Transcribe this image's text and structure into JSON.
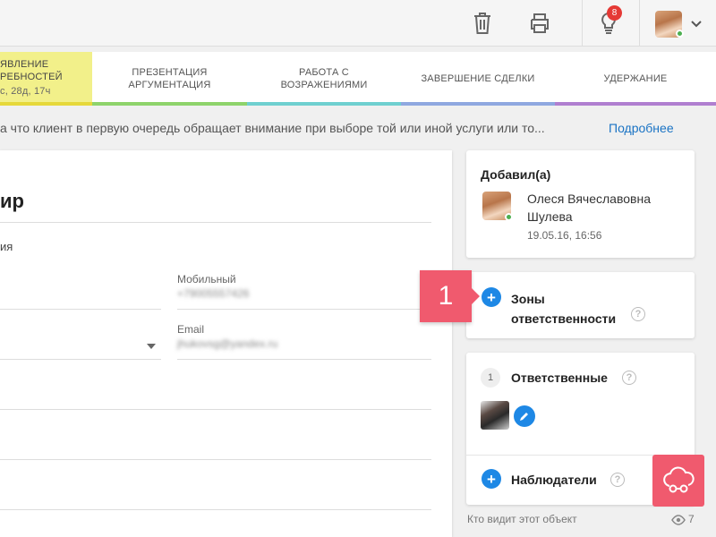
{
  "badge_count": "8",
  "stages": [
    {
      "line1": "ЯВЛЕНИЕ",
      "line2": "РЕБНОСТЕЙ",
      "sub": "с, 28д, 17ч"
    },
    {
      "line1": "ПРЕЗЕНТАЦИЯ",
      "line2": "АРГУМЕНТАЦИЯ"
    },
    {
      "line1": "РАБОТА С",
      "line2": "ВОЗРАЖЕНИЯМИ"
    },
    {
      "line1": "ЗАВЕРШЕНИЕ СДЕЛКИ"
    },
    {
      "line1": "УДЕРЖАНИЕ"
    }
  ],
  "hint": {
    "text": "а что клиент в первую очередь обращает внимание при выборе той или иной услуги или то...",
    "more": "Подробнее"
  },
  "form": {
    "title": "ир",
    "subtitle": "ия",
    "mobile_label": "Мобильный",
    "mobile_value": "+79005557426",
    "email_label": "Email",
    "email_value": "jhukovsg@yandex.ru"
  },
  "added_by": {
    "heading": "Добавил(а)",
    "name_line1": "Олеся Вячеславовна",
    "name_line2": "Шулева",
    "date": "19.05.16, 16:56"
  },
  "zones": {
    "line1": "Зоны",
    "line2": "ответственности",
    "step": "1"
  },
  "responsible": {
    "count": "1",
    "label": "Ответственные"
  },
  "watchers": {
    "label": "Наблюдатели"
  },
  "footer": {
    "text": "Кто видит этот объект",
    "views": "7"
  }
}
